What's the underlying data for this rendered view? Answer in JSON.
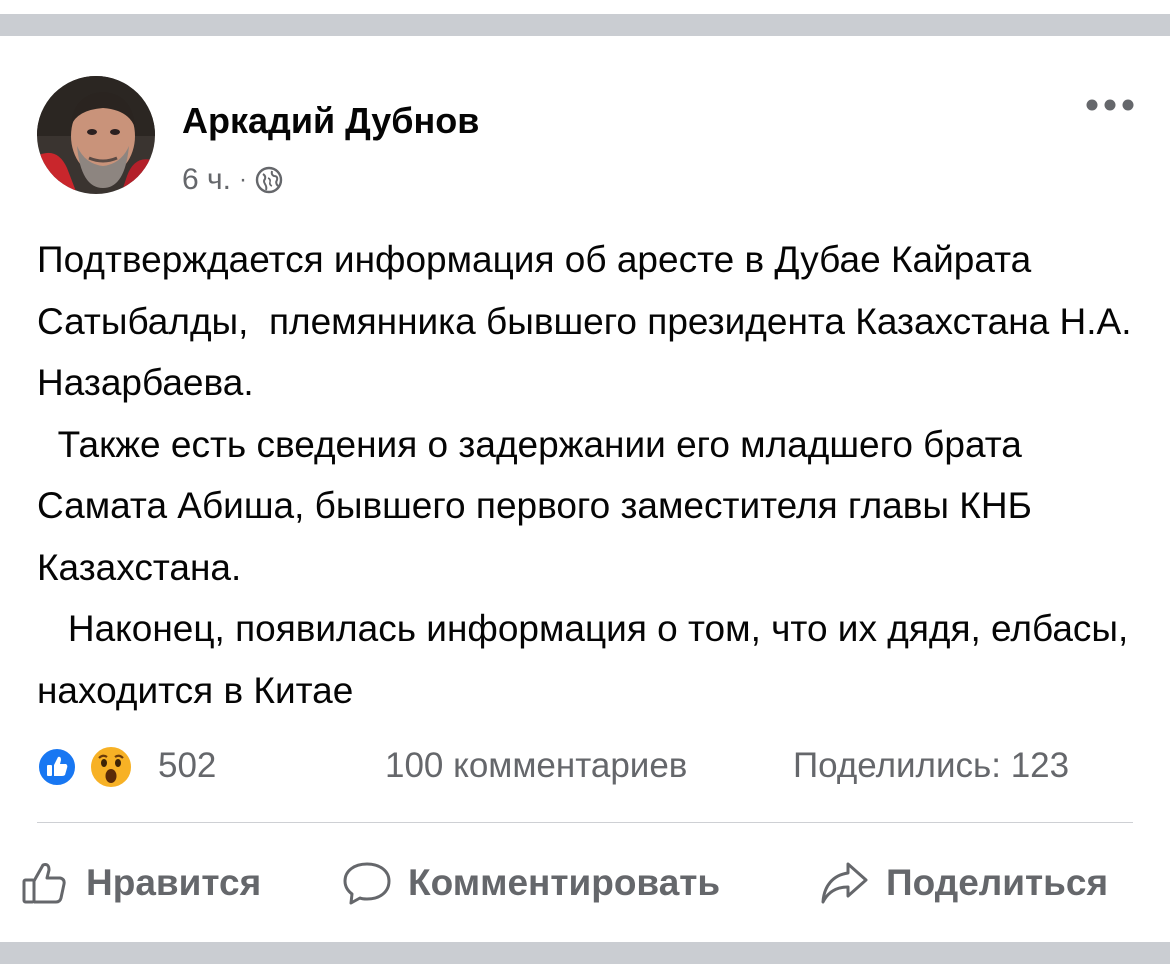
{
  "post": {
    "author": "Аркадий Дубнов",
    "time": "6 ч.",
    "meta_separator": "·",
    "privacy_icon": "globe-icon",
    "more_icon": "more-dots-icon",
    "body": [
      "Подтверждается информация об аресте в Дубае Кайрата Сатыбалды,  племянника бывшего президента Казахстана Н.А. Назарбаева.",
      "  Также есть сведения о задержании его младшего брата Самата Абиша, бывшего первого заместителя главы КНБ Казахстана.",
      "   Наконец, появилась информация о том, что их дядя, елбасы, находится в Китае"
    ]
  },
  "stats": {
    "reactions": [
      "like-reaction-icon",
      "wow-reaction-icon"
    ],
    "reaction_count": "502",
    "comments": "100 комментариев",
    "shares": "Поделились: 123"
  },
  "actions": {
    "like_label": "Нравится",
    "comment_label": "Комментировать",
    "share_label": "Поделиться"
  },
  "colors": {
    "like_blue": "#1877f2",
    "secondary_text": "#65676b",
    "separator": "#cacdd2"
  }
}
